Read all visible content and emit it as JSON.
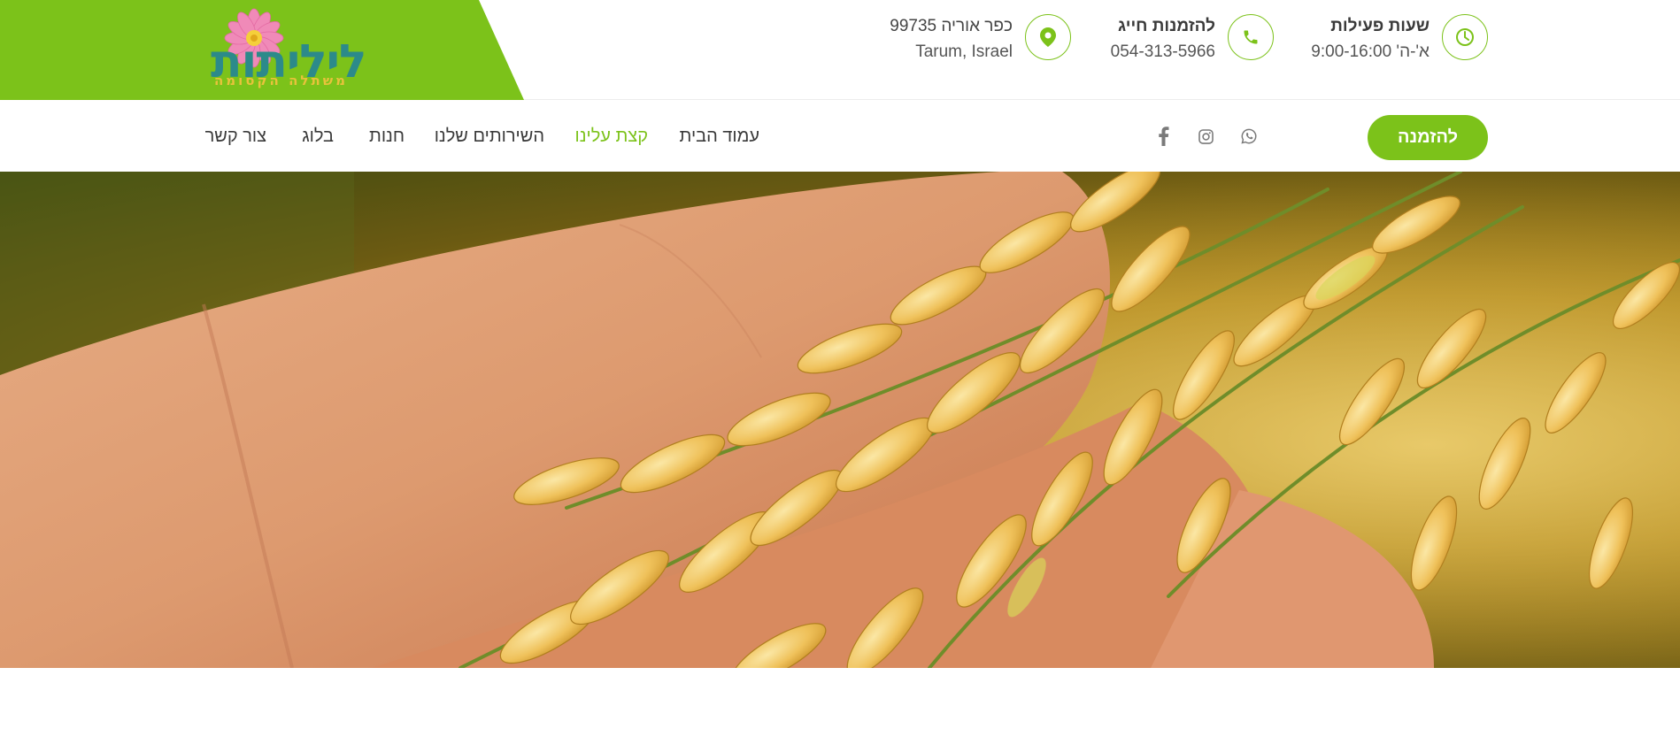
{
  "logo": {
    "name": "ליליתות",
    "tagline": "משתלה הקסומה"
  },
  "header_info": {
    "hours": {
      "title": "שעות פעילות",
      "value": "א'-ה' 9:00-16:00",
      "icon": "clock-icon"
    },
    "phone": {
      "title": "להזמנות חייג",
      "value": "054-313-5966",
      "icon": "phone-icon"
    },
    "address": {
      "line1": "כפר אוריה 99735",
      "line2": "Tarum, Israel",
      "icon": "map-pin-icon"
    }
  },
  "nav": {
    "items": [
      {
        "label": "עמוד הבית",
        "active": false
      },
      {
        "label": "קצת עלינו",
        "active": true
      },
      {
        "label": "השירותים שלנו",
        "active": false
      },
      {
        "label": "חנות",
        "active": false
      },
      {
        "label": "בלוג",
        "active": false
      },
      {
        "label": "צור קשר",
        "active": false
      }
    ],
    "order_button": "להזמנה",
    "social_icons": [
      "whatsapp-icon",
      "instagram-icon",
      "facebook-icon"
    ]
  },
  "colors": {
    "brand_green": "#7cc21a",
    "text_dark": "#3a3a3a"
  }
}
